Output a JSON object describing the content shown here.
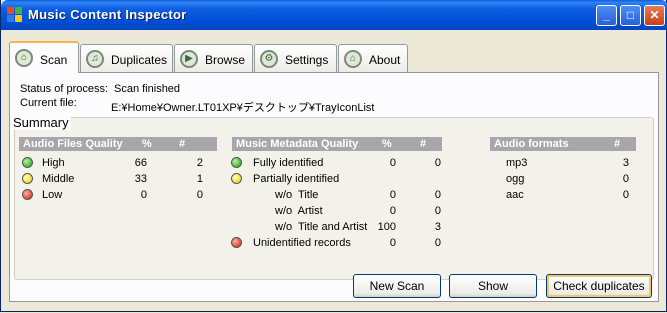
{
  "window": {
    "title": "Music Content Inspector"
  },
  "titlebar_buttons": {
    "minimize": "_",
    "maximize": "□",
    "close": "✕"
  },
  "tabs": [
    {
      "label": "Scan",
      "icon": "scan-icon"
    },
    {
      "label": "Duplicates",
      "icon": "music-note-icon"
    },
    {
      "label": "Browse",
      "icon": "play-icon"
    },
    {
      "label": "Settings",
      "icon": "gear-icon"
    },
    {
      "label": "About",
      "icon": "home-icon"
    }
  ],
  "status": {
    "process_label": "Status of process:",
    "process_value": "Scan finished",
    "file_label": "Current file:",
    "file_value": "E:¥Home¥Owner.LT01XP¥デスクトップ¥TrayIconList"
  },
  "summary": {
    "legend": "Summary",
    "quality": {
      "header": "Audio Files Quality",
      "pct_header": "%",
      "count_header": "#",
      "rows": [
        {
          "label": "High",
          "color": "green",
          "pct": "66",
          "count": "2"
        },
        {
          "label": "Middle",
          "color": "yellow",
          "pct": "33",
          "count": "1"
        },
        {
          "label": "Low",
          "color": "red",
          "pct": "0",
          "count": "0"
        }
      ]
    },
    "metadata": {
      "header": "Music Metadata Quality",
      "pct_header": "%",
      "count_header": "#",
      "rows": [
        {
          "label": "Fully identified",
          "color": "green",
          "pct": "0",
          "count": "0"
        },
        {
          "label": "Partially identified",
          "color": "yellow",
          "pct": "",
          "count": ""
        },
        {
          "label": "w/o  Title",
          "color": "",
          "pct": "0",
          "count": "0"
        },
        {
          "label": "w/o  Artist",
          "color": "",
          "pct": "0",
          "count": "0"
        },
        {
          "label": "w/o  Title and Artist",
          "color": "",
          "pct": "100",
          "count": "3"
        },
        {
          "label": "Unidentified records",
          "color": "red",
          "pct": "0",
          "count": "0"
        }
      ]
    },
    "formats": {
      "header": "Audio formats",
      "count_header": "#",
      "rows": [
        {
          "label": "mp3",
          "count": "3"
        },
        {
          "label": "ogg",
          "count": "0"
        },
        {
          "label": "aac",
          "count": "0"
        }
      ]
    }
  },
  "buttons": {
    "new_scan": "New Scan",
    "show": "Show",
    "check_duplicates": "Check duplicates"
  }
}
